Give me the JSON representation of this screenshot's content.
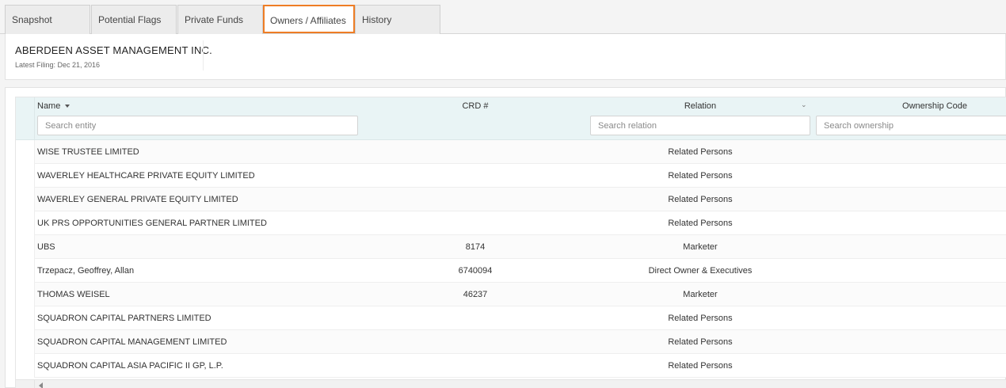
{
  "tabs": [
    {
      "label": "Snapshot",
      "active": false
    },
    {
      "label": "Potential Flags",
      "active": false
    },
    {
      "label": "Private Funds",
      "active": false
    },
    {
      "label": "Owners / Affiliates",
      "active": true
    },
    {
      "label": "History",
      "active": false
    }
  ],
  "accent_color": "#ee7d25",
  "header": {
    "company_name": "ABERDEEN ASSET MANAGEMENT INC.",
    "latest_filing": "Latest Filing: Dec 21, 2016"
  },
  "grid": {
    "columns": {
      "name": "Name",
      "crd": "CRD #",
      "relation": "Relation",
      "ownership": "Ownership Code"
    },
    "filters": {
      "name_placeholder": "Search entity",
      "relation_placeholder": "Search relation",
      "ownership_placeholder": "Search ownership"
    },
    "rows": [
      {
        "name": "WISE TRUSTEE LIMITED",
        "crd": "",
        "relation": "Related Persons"
      },
      {
        "name": "WAVERLEY HEALTHCARE PRIVATE EQUITY LIMITED",
        "crd": "",
        "relation": "Related Persons"
      },
      {
        "name": "WAVERLEY GENERAL PRIVATE EQUITY LIMITED",
        "crd": "",
        "relation": "Related Persons"
      },
      {
        "name": "UK PRS OPPORTUNITIES GENERAL PARTNER LIMITED",
        "crd": "",
        "relation": "Related Persons"
      },
      {
        "name": "UBS",
        "crd": "8174",
        "relation": "Marketer"
      },
      {
        "name": "Trzepacz, Geoffrey, Allan",
        "crd": "6740094",
        "relation": "Direct Owner & Executives"
      },
      {
        "name": "THOMAS WEISEL",
        "crd": "46237",
        "relation": "Marketer"
      },
      {
        "name": "SQUADRON CAPITAL PARTNERS LIMITED",
        "crd": "",
        "relation": "Related Persons"
      },
      {
        "name": "SQUADRON CAPITAL MANAGEMENT LIMITED",
        "crd": "",
        "relation": "Related Persons"
      },
      {
        "name": "SQUADRON CAPITAL ASIA PACIFIC II GP, L.P.",
        "crd": "",
        "relation": "Related Persons"
      }
    ]
  }
}
